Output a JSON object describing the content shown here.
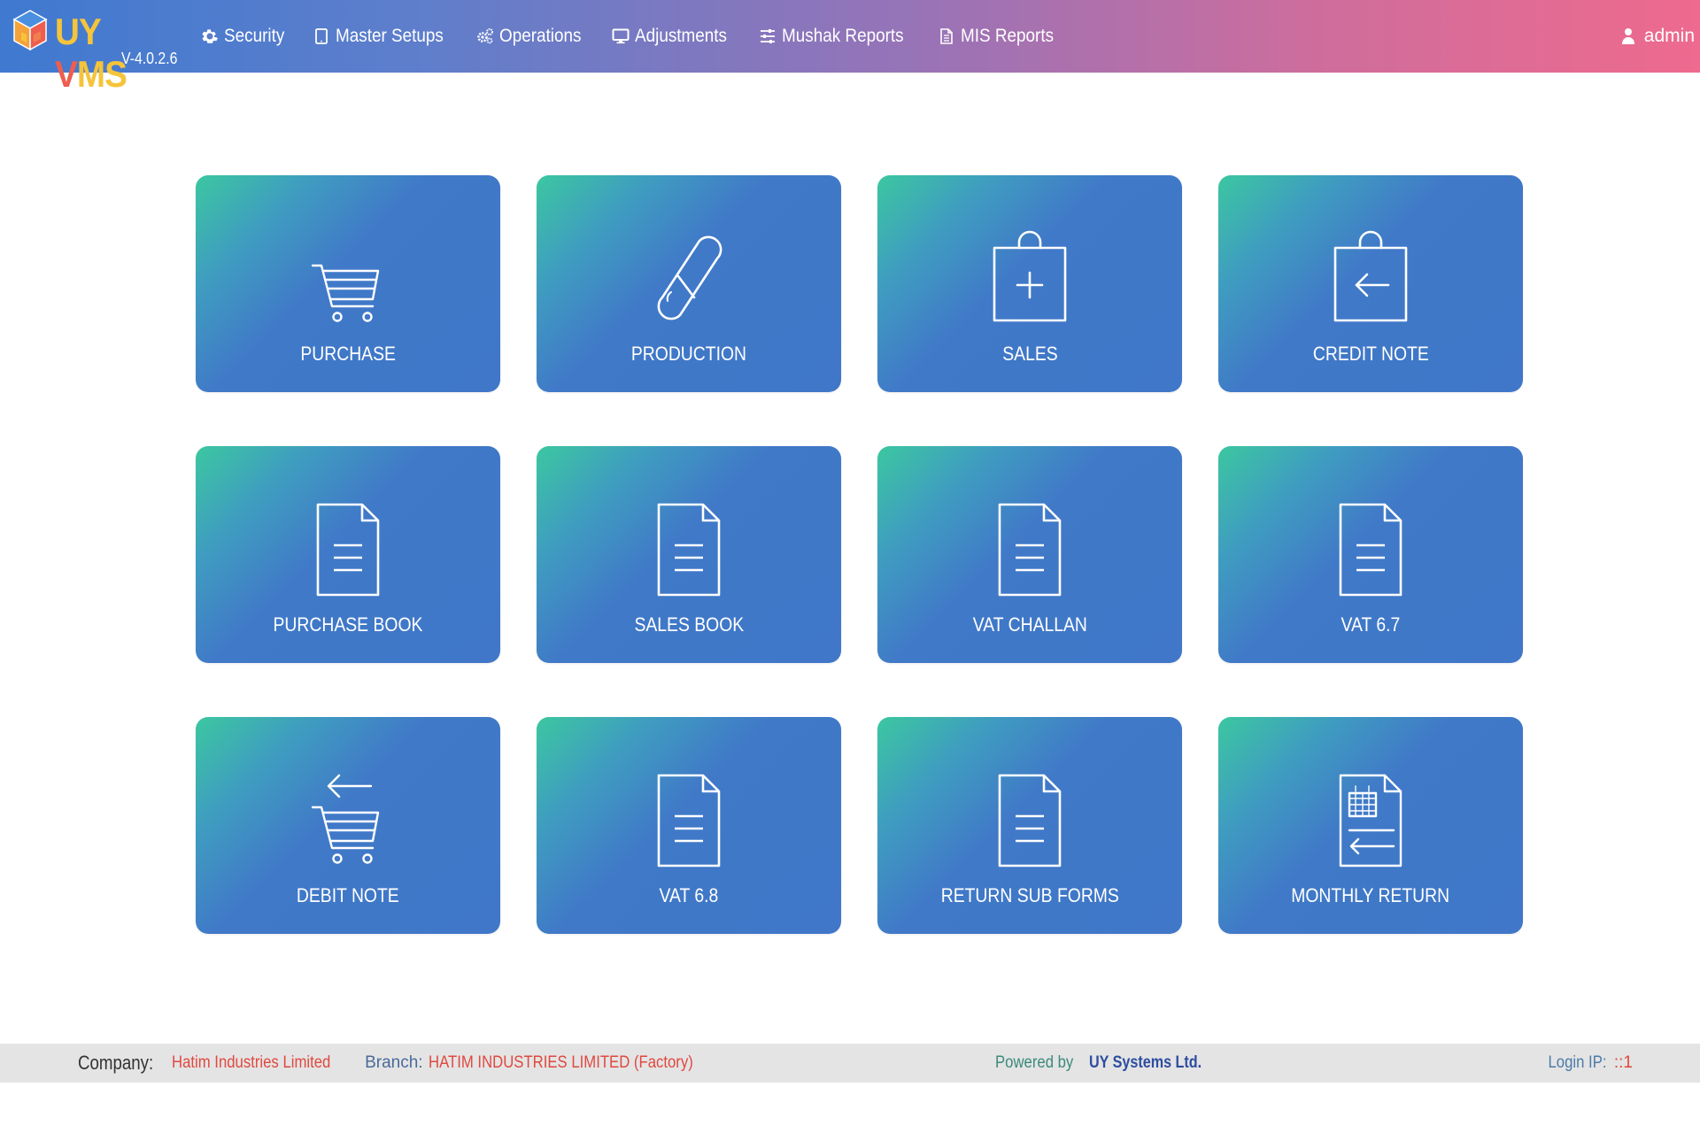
{
  "brand": {
    "name_uy": "UY ",
    "name_v": "V",
    "name_ms": "MS",
    "version": "V-4.0.2.6",
    "colors": {
      "uy": "#f5c43a",
      "v": "#ee5d4e"
    }
  },
  "nav": {
    "items": [
      {
        "label": "Security",
        "icon": "gear-icon"
      },
      {
        "label": "Master Setups",
        "icon": "tablet-icon"
      },
      {
        "label": "Operations",
        "icon": "gears-icon"
      },
      {
        "label": "Adjustments",
        "icon": "monitor-icon"
      },
      {
        "label": "Mushak Reports",
        "icon": "sliders-icon"
      },
      {
        "label": "MIS Reports",
        "icon": "file-text-icon"
      }
    ]
  },
  "user": {
    "name": "admin",
    "icon": "user-icon"
  },
  "tiles": [
    {
      "label": "PURCHASE",
      "icon": "cart-icon"
    },
    {
      "label": "PRODUCTION",
      "icon": "pill-icon"
    },
    {
      "label": "SALES",
      "icon": "bag-plus-icon"
    },
    {
      "label": "CREDIT NOTE",
      "icon": "bag-return-icon"
    },
    {
      "label": "PURCHASE BOOK",
      "icon": "document-icon"
    },
    {
      "label": "SALES BOOK",
      "icon": "document-icon"
    },
    {
      "label": "VAT CHALLAN",
      "icon": "document-icon"
    },
    {
      "label": "VAT 6.7",
      "icon": "document-icon"
    },
    {
      "label": "DEBIT NOTE",
      "icon": "cart-return-icon"
    },
    {
      "label": "VAT 6.8",
      "icon": "document-icon"
    },
    {
      "label": "RETURN SUB FORMS",
      "icon": "document-icon"
    },
    {
      "label": "MONTHLY RETURN",
      "icon": "calendar-doc-icon"
    }
  ],
  "footer": {
    "company_label": "Company:",
    "company_value": "Hatim Industries Limited",
    "branch_label": "Branch:",
    "branch_value": "HATIM INDUSTRIES LIMITED (Factory)",
    "powered_by": "Powered by",
    "powered_company": "UY Systems Ltd.",
    "login_ip_label": "Login IP:",
    "login_ip_value": "::1"
  },
  "colors": {
    "tile_gradient_start": "#3cc7a0",
    "tile_gradient_end": "#4077c9",
    "accent_red": "#e0483f",
    "footer_bg": "#e4e4e4"
  }
}
